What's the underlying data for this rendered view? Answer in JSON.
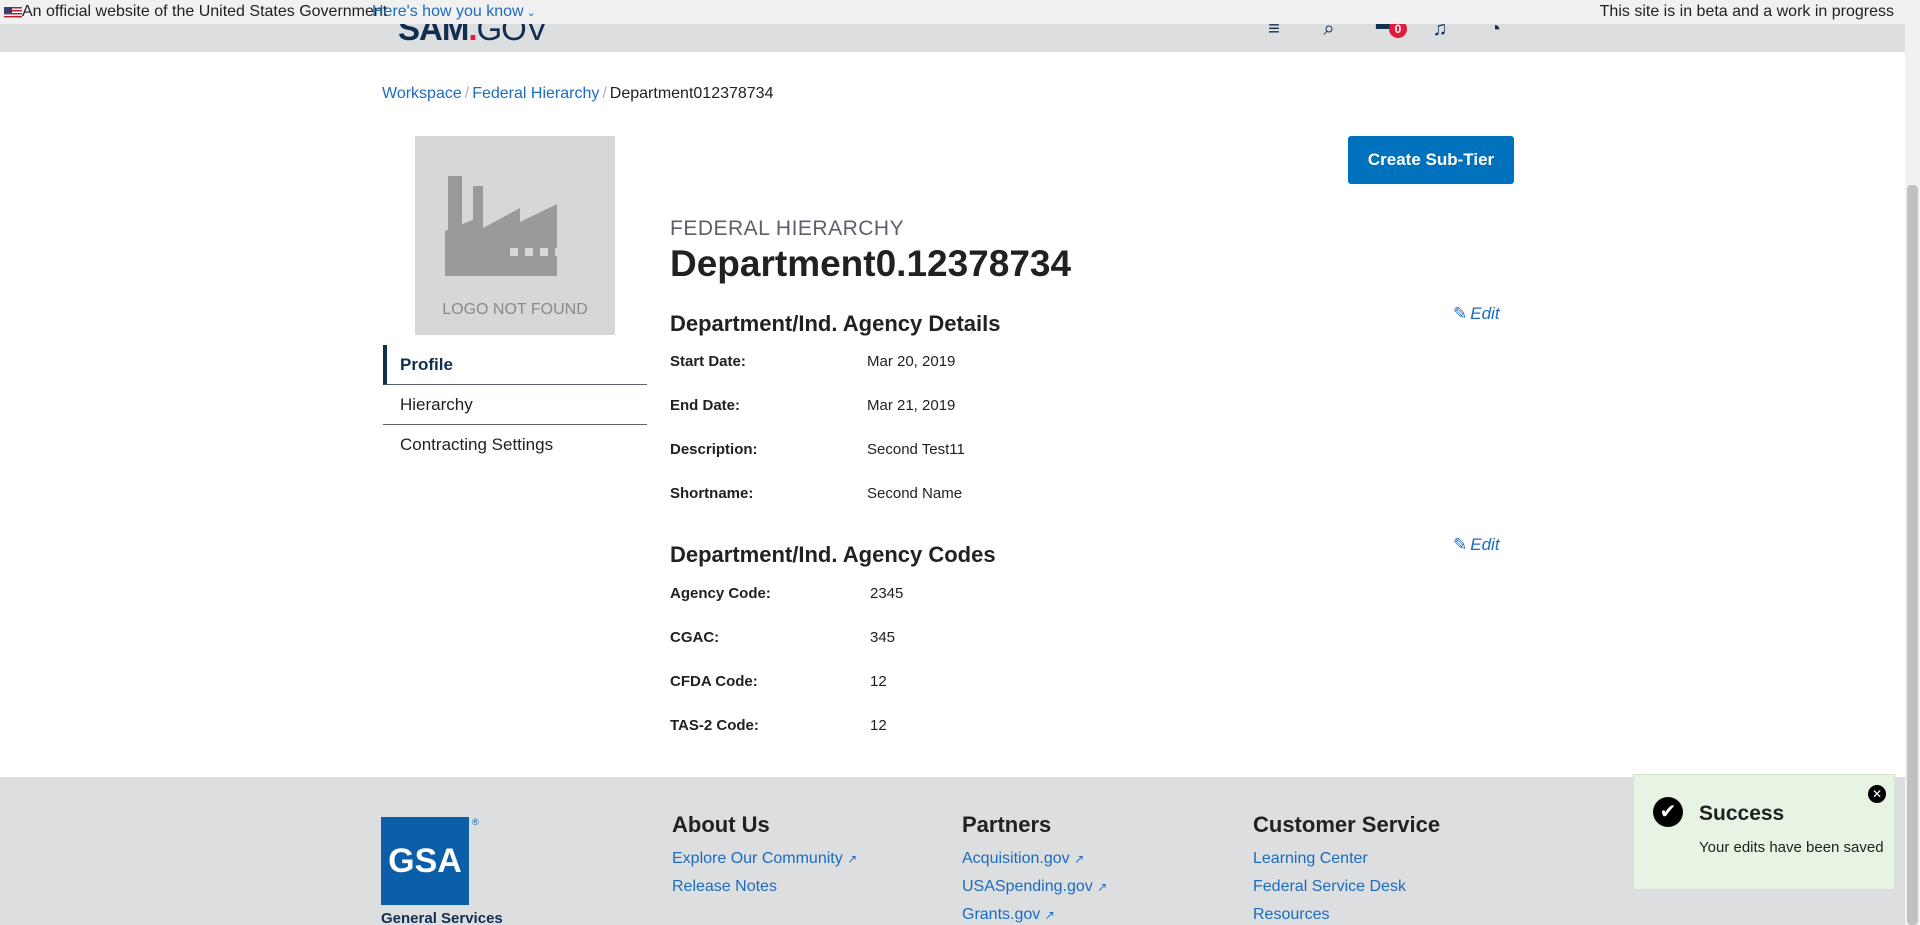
{
  "gov_banner": {
    "official_text": "An official website of the United States Government",
    "how_you_know": "Here's how you know",
    "beta_text": "This site is in beta and a work in progress"
  },
  "header": {
    "logo_main": "SAM",
    "logo_dot": ".",
    "logo_gov": "GOV",
    "icons": [
      "menu-icon",
      "search-icon",
      "cart-icon",
      "bell-icon",
      "help-icon"
    ],
    "cart_count": "0"
  },
  "breadcrumb": {
    "items": [
      "Workspace",
      "Federal Hierarchy"
    ],
    "current": "Department012378734",
    "separator": "/"
  },
  "logo_placeholder": {
    "text": "LOGO NOT FOUND"
  },
  "side_nav": {
    "items": [
      "Profile",
      "Hierarchy",
      "Contracting Settings"
    ]
  },
  "actions": {
    "create_sub_tier": "Create Sub-Tier"
  },
  "page": {
    "eyebrow": "FEDERAL HIERARCHY",
    "title": "Department0.12378734"
  },
  "details": {
    "title": "Department/Ind. Agency Details",
    "edit": "Edit",
    "fields": [
      {
        "label": "Start Date:",
        "value": "Mar 20, 2019"
      },
      {
        "label": "End Date:",
        "value": "Mar 21, 2019"
      },
      {
        "label": "Description:",
        "value": "Second Test11"
      },
      {
        "label": "Shortname:",
        "value": "Second Name"
      }
    ]
  },
  "codes": {
    "title": "Department/Ind. Agency Codes",
    "edit": "Edit",
    "fields": [
      {
        "label": "Agency Code:",
        "value": "2345"
      },
      {
        "label": "CGAC:",
        "value": "345"
      },
      {
        "label": "CFDA Code:",
        "value": "12"
      },
      {
        "label": "TAS-2 Code:",
        "value": "12"
      }
    ]
  },
  "footer": {
    "gsa_logo": "GSA",
    "gsa_reg": "®",
    "gsa_sub": "General Services",
    "about": {
      "title": "About Us",
      "links": [
        "Explore Our Community",
        "Release Notes"
      ]
    },
    "partners": {
      "title": "Partners",
      "links": [
        "Acquisition.gov",
        "USASpending.gov",
        "Grants.gov"
      ]
    },
    "customer_service": {
      "title": "Customer Service",
      "links": [
        "Learning Center",
        "Federal Service Desk",
        "Resources"
      ]
    }
  },
  "toast": {
    "title": "Success",
    "message": "Your edits have been saved"
  },
  "colors": {
    "accent": "#0071bc",
    "link": "#1b6cc0",
    "navy": "#112e51",
    "success_bg": "#e7f4e4"
  }
}
